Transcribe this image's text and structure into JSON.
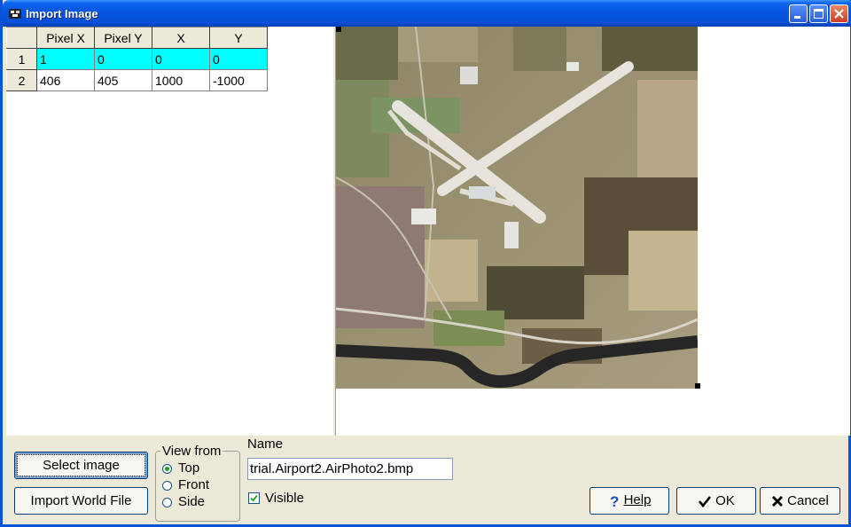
{
  "window": {
    "title": "Import Image",
    "icon": "app-icon",
    "controls": [
      "minimize-icon",
      "maximize-icon",
      "close-icon"
    ]
  },
  "grid": {
    "columns": [
      "Pixel X",
      "Pixel Y",
      "X",
      "Y"
    ],
    "rows": [
      {
        "num": "1",
        "cells": [
          "1",
          "0",
          "0",
          "0"
        ],
        "selected": true
      },
      {
        "num": "2",
        "cells": [
          "406",
          "405",
          "1000",
          "-1000"
        ],
        "selected": false
      }
    ],
    "selected_color": "#00ffff"
  },
  "buttons": {
    "select_image": "Select image",
    "import_world_file": "Import World File",
    "help": "Help",
    "ok": "OK",
    "cancel": "Cancel"
  },
  "view_from": {
    "title": "View from",
    "options": [
      "Top",
      "Front",
      "Side"
    ],
    "selected": "Top"
  },
  "name": {
    "label": "Name",
    "value": "trial.Airport2.AirPhoto2.bmp"
  },
  "visible": {
    "label": "Visible",
    "checked": true
  },
  "colors": {
    "title_bar": "#0a5ae6",
    "dialog_bg": "#ece9d8",
    "accent_check": "#21a121"
  }
}
